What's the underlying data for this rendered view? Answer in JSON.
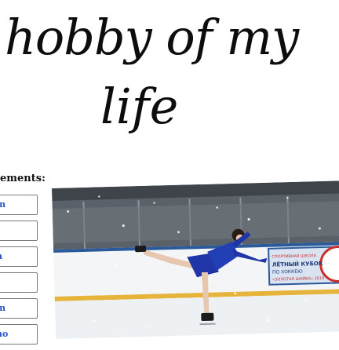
{
  "title": {
    "line1": "hobby of my",
    "line2": "life"
  },
  "elements": {
    "heading": "ements:",
    "items": [
      {
        "label": "in"
      },
      {
        "label": ""
      },
      {
        "label": "n"
      },
      {
        "label": ""
      },
      {
        "label": "in"
      },
      {
        "label": "ho"
      }
    ]
  },
  "photo": {
    "subject": "figure skater performing spiral on ice",
    "banner_text": [
      "СПОРТИВНАЯ ШКОЛА",
      "ЛЁТНЫЙ КУБОК",
      "ПО ХОККЕЮ",
      "«ЗОЛОТАЯ ШАЙБА» 2019"
    ],
    "colors": {
      "ice": "#eef1f4",
      "wall": "#4a4f54",
      "costume": "#1f35a8",
      "rail": "#c9302c"
    }
  }
}
